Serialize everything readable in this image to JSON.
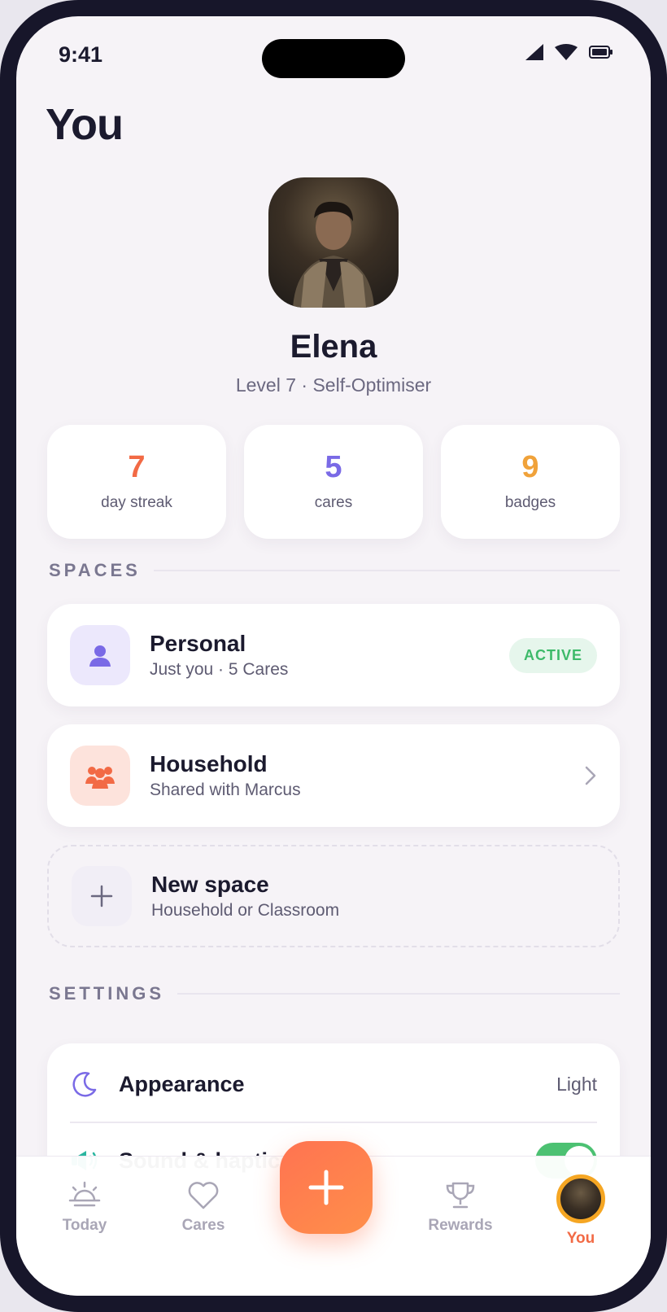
{
  "status_bar": {
    "time": "9:41"
  },
  "page_title": "You",
  "profile": {
    "name": "Elena",
    "subtitle": "Level 7 · Self-Optimiser"
  },
  "stats": [
    {
      "value": "7",
      "label": "day streak",
      "color": "#f26a45"
    },
    {
      "value": "5",
      "label": "cares",
      "color": "#7a6ae6"
    },
    {
      "value": "9",
      "label": "badges",
      "color": "#f0a23a"
    }
  ],
  "spaces": {
    "heading": "SPACES",
    "items": [
      {
        "title": "Personal",
        "subtitle": "Just you · 5 Cares",
        "badge": "ACTIVE",
        "icon": "person-icon"
      },
      {
        "title": "Household",
        "subtitle": "Shared with Marcus",
        "icon": "group-icon"
      },
      {
        "title": "New space",
        "subtitle": "Household or Classroom",
        "icon": "plus-icon"
      }
    ]
  },
  "settings": {
    "heading": "SETTINGS",
    "appearance": {
      "label": "Appearance",
      "value": "Light"
    },
    "sound": {
      "label": "Sound & haptics",
      "enabled": true
    }
  },
  "tabbar": {
    "today": "Today",
    "cares": "Cares",
    "rewards": "Rewards",
    "you": "You"
  },
  "colors": {
    "accent": "#f26a45",
    "active_green": "#3dba6a",
    "purple": "#7a6ae6"
  }
}
